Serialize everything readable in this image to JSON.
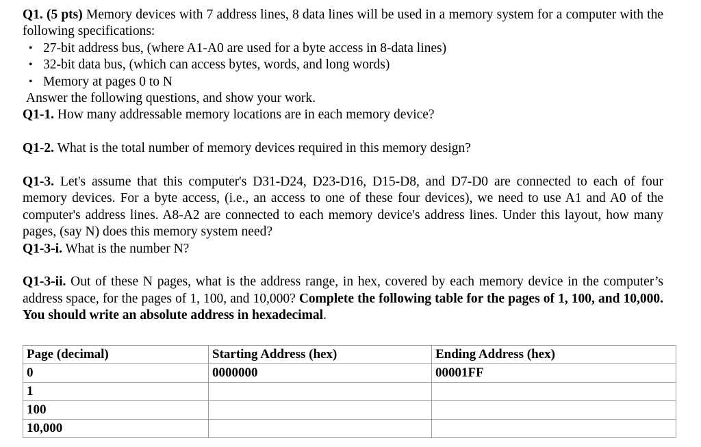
{
  "document": {
    "question": {
      "label": "Q1.",
      "points": "(5 pts)",
      "intro_text": " Memory devices with 7 address lines, 8 data lines will be used in a memory system for a computer with the following specifications:",
      "bullet_marker": "•",
      "bullets": [
        "27-bit address bus, (where A1-A0 are used for a byte access in 8-data lines)",
        "32-bit data bus, (which can access bytes, words, and long words)",
        "Memory at pages 0 to N"
      ],
      "answer_instruction": "Answer the following questions, and show your work."
    },
    "subquestions": [
      {
        "label": "Q1-1.",
        "text": " How many addressable memory locations are in each memory device?"
      },
      {
        "label": "Q1-2.",
        "text": " What is the total number of memory devices required in this memory design?"
      },
      {
        "label": "Q1-3.",
        "text": " Let's assume that this computer's D31-D24, D23-D16, D15-D8, and D7-D0 are connected to each of four memory devices. For a byte access, (i.e., an access to one of these four devices), we need to use A1 and A0 of the computer's address lines. A8-A2 are connected to each memory device's address lines. Under this layout, how many pages, (say N) does this memory system need?"
      },
      {
        "label": "Q1-3-i.",
        "text": " What is the number N?"
      },
      {
        "label": "Q1-3-ii.",
        "text": " Out of these N pages, what is the address range, in hex, covered by each memory device in the computer’s address space, for the pages of 1, 100, and 10,000? ",
        "bold_text": "Complete the following table for the pages of 1, 100, and 10,000. You should write an absolute address in hexadecimal",
        "tail_text": "."
      }
    ],
    "table": {
      "headers": [
        "Page (decimal)",
        "Starting Address (hex)",
        "Ending Address (hex)"
      ],
      "rows": [
        [
          "0",
          "0000000",
          "00001FF"
        ],
        [
          "1",
          "",
          ""
        ],
        [
          "100",
          "",
          ""
        ],
        [
          "10,000",
          "",
          ""
        ]
      ]
    }
  }
}
